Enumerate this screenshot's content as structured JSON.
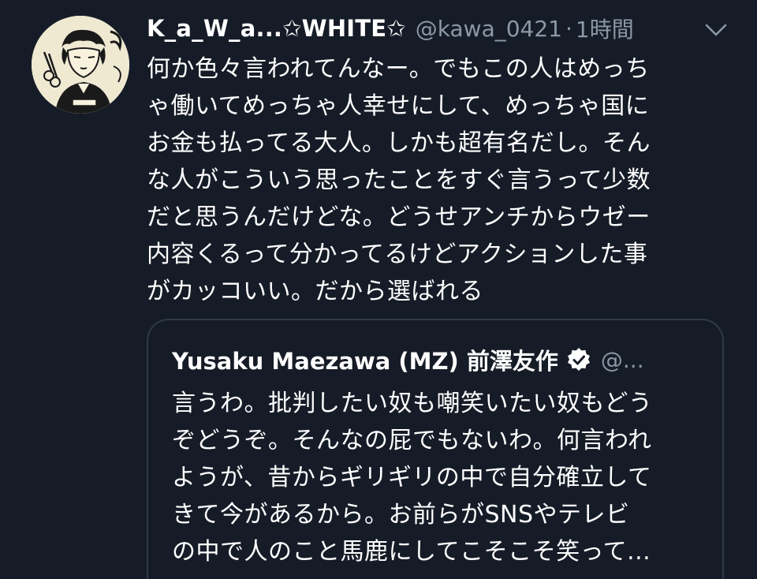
{
  "colors": {
    "background": "#161c27",
    "text_primary": "#ffffff",
    "text_secondary": "#8b98a5",
    "border": "#2f3945"
  },
  "tweet": {
    "avatar_icon": "user-avatar-illustration",
    "display_name": "K_a_W_a...✩WHITE✩",
    "handle": "@kawa_0421",
    "separator": "·",
    "time": "1時間",
    "menu_icon": "chevron-down-icon",
    "text_lines": [
      "何か色々言われてんなー。でもこの人はめっち",
      "ゃ働いてめっちゃ人幸せにして、めっちゃ国に",
      "お金も払ってる大人。しかも超有名だし。そん",
      "な人がこういう思ったことをすぐ言うって少数",
      "だと思うんだけどな。どうせアンチからウゼー",
      "内容くるって分かってるけどアクションした事",
      "がカッコいい。だから選ばれる"
    ]
  },
  "quoted_tweet": {
    "display_name": "Yusaku Maezawa (MZ) 前澤友作",
    "verified_icon": "verified-badge-icon",
    "handle": "@...",
    "text_lines": [
      "言うわ。批判したい奴も嘲笑いたい奴もどう",
      "ぞどうぞ。そんなの屁でもないわ。何言われ",
      "ようが、昔からギリギリの中で自分確立して",
      "きて今があるから。お前らがSNSやテレビ",
      "の中で人のこと馬鹿にしてこそこそ笑って..."
    ]
  }
}
